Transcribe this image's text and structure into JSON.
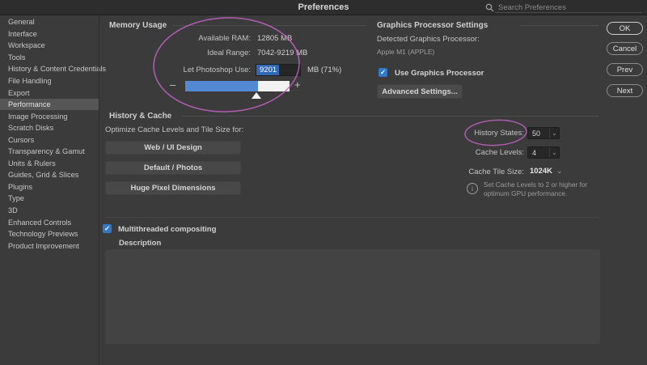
{
  "titlebar": {
    "title": "Preferences",
    "search_placeholder": "Search Preferences"
  },
  "sidebar": {
    "items": [
      {
        "label": "General",
        "selected": false
      },
      {
        "label": "Interface",
        "selected": false
      },
      {
        "label": "Workspace",
        "selected": false
      },
      {
        "label": "Tools",
        "selected": false
      },
      {
        "label": "History & Content Credentials",
        "selected": false
      },
      {
        "label": "File Handling",
        "selected": false
      },
      {
        "label": "Export",
        "selected": false
      },
      {
        "label": "Performance",
        "selected": true
      },
      {
        "label": "Image Processing",
        "selected": false
      },
      {
        "label": "Scratch Disks",
        "selected": false
      },
      {
        "label": "Cursors",
        "selected": false
      },
      {
        "label": "Transparency & Gamut",
        "selected": false
      },
      {
        "label": "Units & Rulers",
        "selected": false
      },
      {
        "label": "Guides, Grid & Slices",
        "selected": false
      },
      {
        "label": "Plugins",
        "selected": false
      },
      {
        "label": "Type",
        "selected": false
      },
      {
        "label": "3D",
        "selected": false
      },
      {
        "label": "Enhanced Controls",
        "selected": false
      },
      {
        "label": "Technology Previews",
        "selected": false
      },
      {
        "label": "Product Improvement",
        "selected": false
      }
    ]
  },
  "dialog_buttons": {
    "ok": "OK",
    "cancel": "Cancel",
    "prev": "Prev",
    "next": "Next"
  },
  "memory": {
    "header": "Memory Usage",
    "available_ram_label": "Available RAM:",
    "available_ram_value": "12805 MB",
    "ideal_range_label": "Ideal Range:",
    "ideal_range_value": "7042-9219 MB",
    "let_use_label": "Let Photoshop Use:",
    "let_use_value": "9201",
    "let_use_suffix": "MB (71%)",
    "slider_percent": 71
  },
  "gpu": {
    "header": "Graphics Processor Settings",
    "detected_label": "Detected Graphics Processor:",
    "detected_value": "Apple M1 (APPLE)",
    "use_gpu_label": "Use Graphics Processor",
    "use_gpu_checked": true,
    "advanced_button": "Advanced Settings..."
  },
  "history_cache": {
    "header": "History & Cache",
    "optimize_label": "Optimize Cache Levels and Tile Size for:",
    "preset_buttons": [
      "Web / UI Design",
      "Default / Photos",
      "Huge Pixel Dimensions"
    ],
    "history_states_label": "History States:",
    "history_states_value": "50",
    "cache_levels_label": "Cache Levels:",
    "cache_levels_value": "4",
    "cache_tile_label": "Cache Tile Size:",
    "cache_tile_value": "1024K",
    "info_text": "Set Cache Levels to 2 or higher for optimum GPU performance."
  },
  "compositing": {
    "multithreaded_label": "Multithreaded compositing",
    "multithreaded_checked": true,
    "description_label": "Description"
  },
  "icons": {
    "check": "✓",
    "chevron_down": "⌄",
    "info": "i",
    "minus": "–",
    "plus": "+"
  },
  "colors": {
    "accent_blue": "#3178c6",
    "selection_blue": "#3069b5",
    "slider_blue": "#5389d3",
    "annotation_pink": "#bf63bf"
  }
}
